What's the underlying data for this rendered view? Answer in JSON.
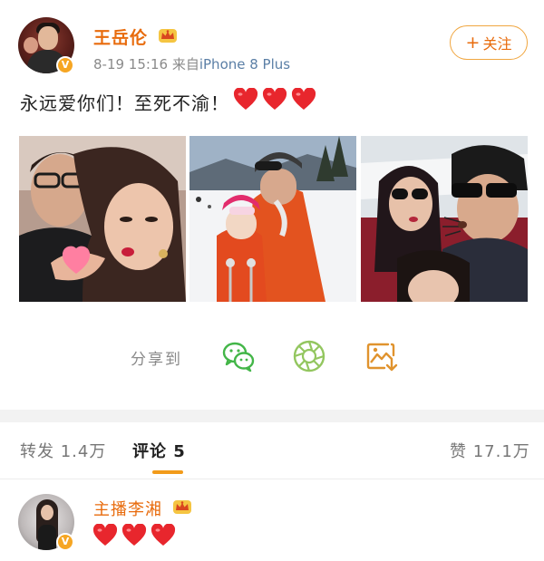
{
  "post": {
    "author": "王岳伦",
    "date_time": "8-19 15:16",
    "source_prefix": "来自",
    "source_device": "iPhone 8 Plus",
    "follow_label": "关注",
    "follow_plus": "+",
    "verified_badge": "V",
    "text": "永远爱你们！至死不渝！",
    "heart_count": 3,
    "heart_color": "#e8262d",
    "photos": [
      "photo-couple-selfie",
      "photo-ski-father-daughter",
      "photo-family-yacht"
    ]
  },
  "share": {
    "label": "分享到",
    "icons": [
      "wechat-icon",
      "moments-icon",
      "save-image-icon"
    ]
  },
  "tabs": {
    "repost": "转发 1.4万",
    "comment": "评论 5",
    "like": "赞 17.1万"
  },
  "comment": {
    "user": "主播李湘",
    "verified_badge": "V",
    "heart_count": 3
  },
  "colors": {
    "username": "#e86b0c",
    "accent": "#f29b1a",
    "meta": "#8a8a8a",
    "share_icon_green": "#43b648",
    "moments_green": "#93c65f",
    "save_orange": "#e0932e"
  }
}
